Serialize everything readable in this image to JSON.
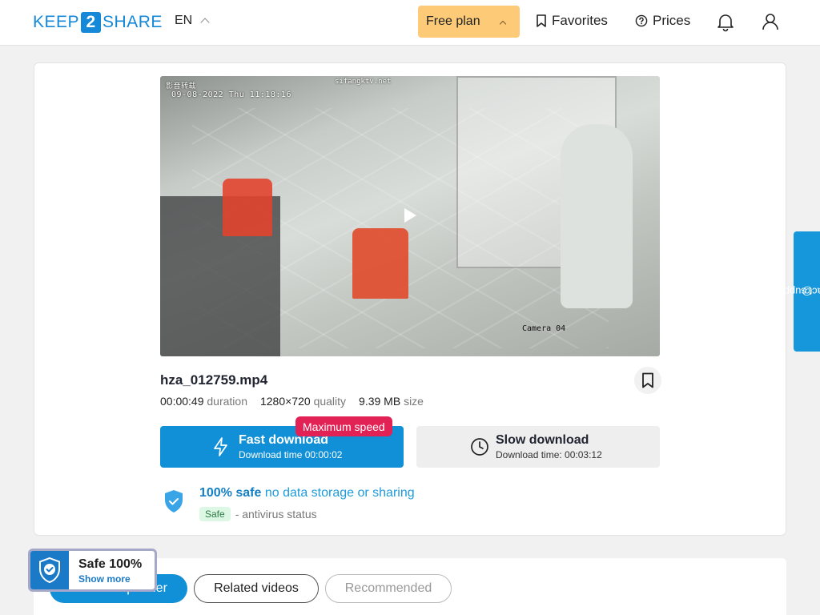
{
  "header": {
    "logo_left": "KEEP",
    "logo_mid": "2",
    "logo_right": "SHARE",
    "lang": "EN",
    "plan_label": "Free plan",
    "favorites_label": "Favorites",
    "prices_label": "Prices"
  },
  "video": {
    "overlay_timestamp": "09-08-2022 Thu 11:18:16",
    "overlay_site": "sifangktv.net",
    "overlay_top": "影音转载",
    "overlay_camera": "Camera 04"
  },
  "file": {
    "name": "hza_012759.mp4",
    "duration_value": "00:00:49",
    "duration_label": "duration",
    "quality_value": "1280×720",
    "quality_label": "quality",
    "size_value": "9.39 MB",
    "size_label": "size"
  },
  "download": {
    "fast_title": "Fast download",
    "fast_sub": "Download time 00:00:02",
    "max_badge": "Maximum speed",
    "slow_title": "Slow download",
    "slow_sub": "Download time: 00:03:12"
  },
  "safety": {
    "strong": "100% safe",
    "soft": "no data storage or sharing",
    "tag": "Safe",
    "status": "- antivirus status"
  },
  "support_label": "contact support",
  "support_at": "@",
  "tabs": [
    "From this partner",
    "Related videos",
    "Recommended"
  ],
  "safe_widget": {
    "title": "Safe 100%",
    "link": "Show more"
  },
  "colors": {
    "brand": "#1589d8",
    "plan": "#fdca78",
    "badge": "#e22155"
  }
}
